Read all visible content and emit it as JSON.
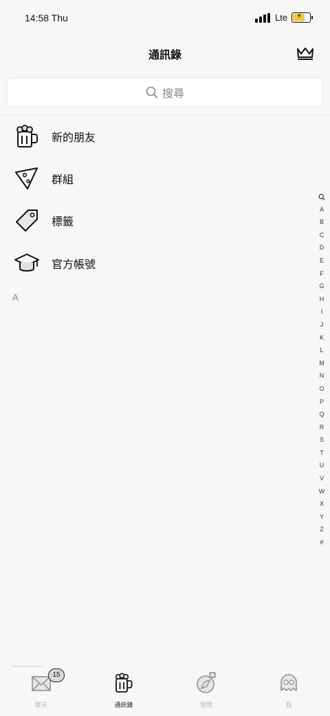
{
  "status_bar": {
    "time": "14:58 Thu",
    "network": "Lte"
  },
  "header": {
    "title": "通訊錄"
  },
  "search": {
    "placeholder": "搜尋"
  },
  "menu": [
    {
      "label": "新的朋友",
      "icon": "beer-mug-icon"
    },
    {
      "label": "群組",
      "icon": "pizza-slice-icon"
    },
    {
      "label": "標籤",
      "icon": "price-tag-icon"
    },
    {
      "label": "官方帳號",
      "icon": "graduation-cap-icon"
    }
  ],
  "section_header": "A",
  "index_letters": [
    "A",
    "B",
    "C",
    "D",
    "E",
    "F",
    "G",
    "H",
    "I",
    "J",
    "K",
    "L",
    "M",
    "N",
    "O",
    "P",
    "Q",
    "R",
    "S",
    "T",
    "U",
    "V",
    "W",
    "X",
    "Y",
    "Z",
    "#"
  ],
  "tabs": [
    {
      "label": "聊天",
      "icon": "envelope-icon",
      "badge": "15",
      "active": false
    },
    {
      "label": "通訊錄",
      "icon": "beer-mug-icon",
      "active": true
    },
    {
      "label": "發現",
      "icon": "compass-icon",
      "active": false
    },
    {
      "label": "我",
      "icon": "ghost-icon",
      "active": false
    }
  ],
  "colors": {
    "background": "#f7f7f7",
    "battery": "#f2c93a",
    "inactive_tab": "#b5b5b5"
  }
}
